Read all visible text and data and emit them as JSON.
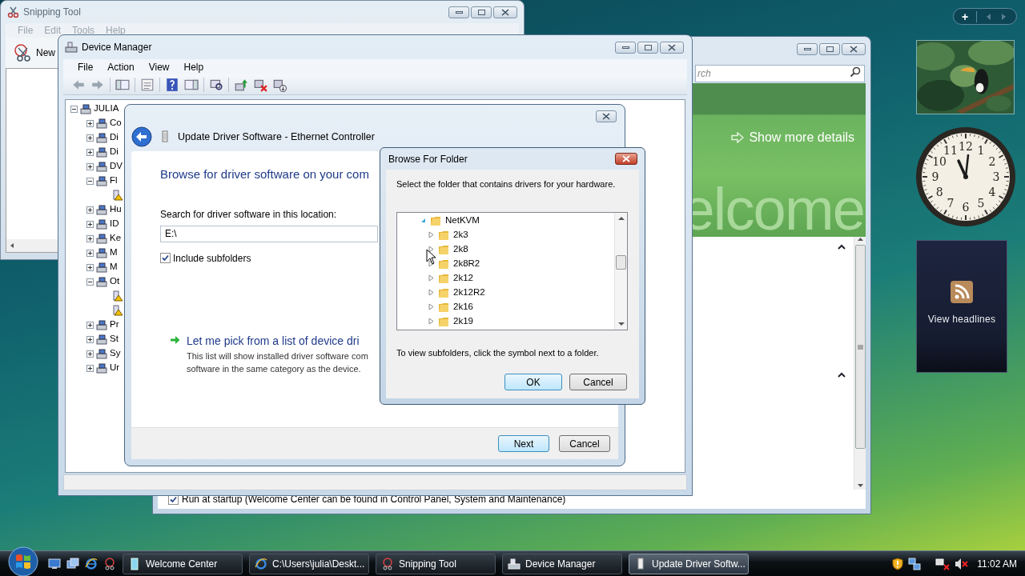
{
  "snipping_tool": {
    "title": "Snipping Tool",
    "menu": [
      "File",
      "Edit",
      "Tools",
      "Help"
    ],
    "new_button": "New"
  },
  "welcome_center": {
    "search": {
      "placeholder": "rch"
    },
    "banner_link": "Show more details",
    "banner_text": "elcome",
    "startup": {
      "label": "Run at startup (Welcome Center can be found in Control Panel, System and Maintenance)",
      "checked": true
    }
  },
  "device_manager": {
    "title": "Device Manager",
    "menu": [
      "File",
      "Action",
      "View",
      "Help"
    ],
    "tree": {
      "label": "JULIA",
      "expanded": true,
      "children": [
        {
          "label": "Co",
          "expanded": false
        },
        {
          "label": "Di",
          "expanded": false
        },
        {
          "label": "Di",
          "expanded": false
        },
        {
          "label": "DV",
          "expanded": false
        },
        {
          "label": "Fl",
          "expanded": true,
          "children": [
            {
              "kind": "warning_device"
            }
          ]
        },
        {
          "label": "Hu",
          "expanded": false
        },
        {
          "label": "ID",
          "expanded": false
        },
        {
          "label": "Ke",
          "expanded": false
        },
        {
          "label": "M",
          "expanded": false
        },
        {
          "label": "M",
          "expanded": false
        },
        {
          "label": "Ot",
          "expanded": true,
          "children": [
            {
              "kind": "warning_device"
            },
            {
              "kind": "warning_device"
            }
          ]
        },
        {
          "label": "Pr",
          "expanded": false
        },
        {
          "label": "St",
          "expanded": false
        },
        {
          "label": "Sy",
          "expanded": false
        },
        {
          "label": "Ur",
          "expanded": false
        }
      ]
    }
  },
  "update_driver": {
    "title": "Update Driver Software - Ethernet Controller",
    "heading": "Browse for driver software on your com",
    "location_label": "Search for driver software in this location:",
    "location_value": "E:\\",
    "include_subfolders": {
      "label": "Include subfolders",
      "checked": true
    },
    "pick_link": "Let me pick from a list of device dri",
    "pick_description": [
      "This list will show installed driver software com",
      "software in the same category as the device."
    ],
    "buttons": [
      "Next",
      "Cancel"
    ]
  },
  "browse_folder": {
    "title": "Browse For Folder",
    "instruction": "Select the folder that contains drivers for your hardware.",
    "tree": {
      "label": "NetKVM",
      "expanded": true,
      "children": [
        {
          "label": "2k3",
          "expanded": false
        },
        {
          "label": "2k8",
          "expanded": false
        },
        {
          "label": "2k8R2",
          "expanded": false
        },
        {
          "label": "2k12",
          "expanded": false
        },
        {
          "label": "2k12R2",
          "expanded": false
        },
        {
          "label": "2k16",
          "expanded": false
        },
        {
          "label": "2k19",
          "expanded": false
        }
      ]
    },
    "note": "To view subfolders, click the symbol next to a folder.",
    "buttons": [
      "OK",
      "Cancel"
    ]
  },
  "gadgets": {
    "add_button": "+",
    "clock": {
      "numerals": [
        "12",
        "11",
        "1",
        "10",
        "2",
        "9",
        "3",
        "8",
        "4",
        "7",
        "5",
        "6"
      ]
    },
    "feed": {
      "label": "View headlines"
    }
  },
  "taskbar": {
    "tasks": [
      {
        "label": "Welcome Center",
        "selected": false
      },
      {
        "label": "C:\\Users\\julia\\Deskt...",
        "selected": false
      },
      {
        "label": "Snipping Tool",
        "selected": false
      },
      {
        "label": "Device Manager",
        "selected": false
      },
      {
        "label": "Update Driver Softw...",
        "selected": true
      }
    ],
    "clock": "11:02 AM"
  }
}
